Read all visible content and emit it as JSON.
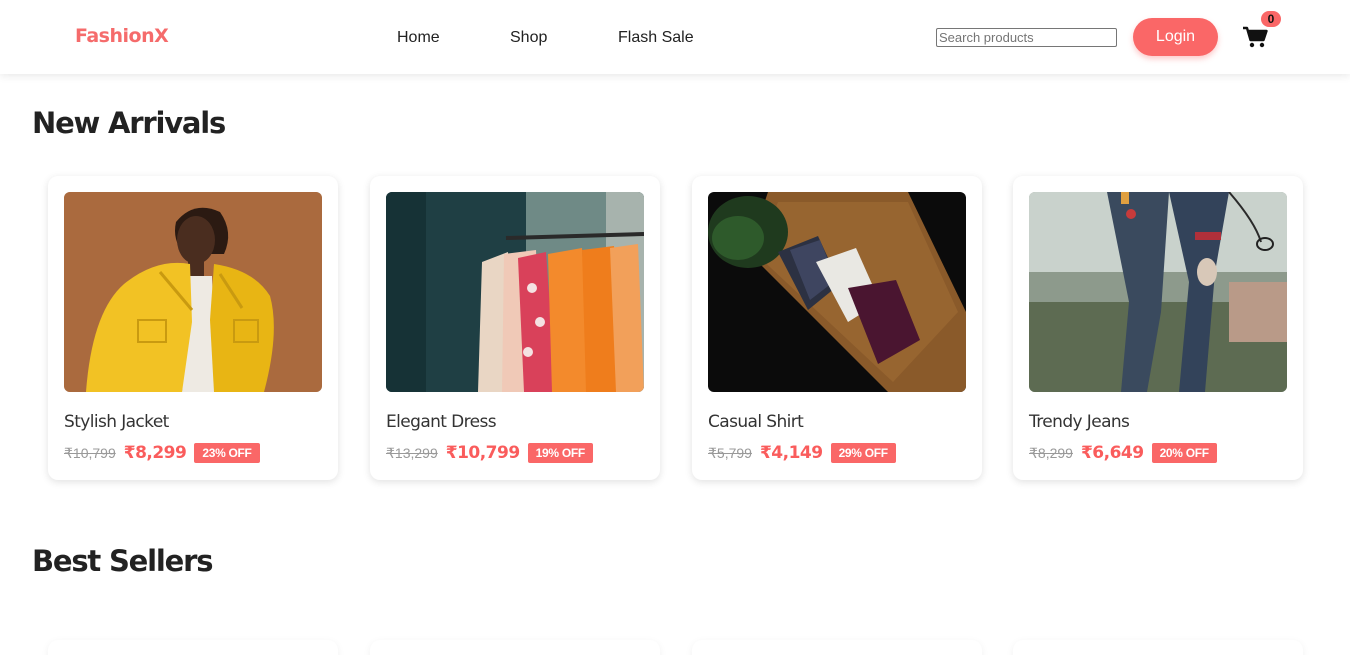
{
  "header": {
    "logo": "FashionX",
    "nav": [
      "Home",
      "Shop",
      "Flash Sale"
    ],
    "search_placeholder": "Search products",
    "search_value": "",
    "login_label": "Login",
    "cart_icon": "shopping-cart-icon",
    "cart_count": "0"
  },
  "colors": {
    "accent": "#fa6767",
    "logo": "#f56b6b",
    "price": "#fa5c5c"
  },
  "new_arrivals": {
    "title": "New Arrivals",
    "products": [
      {
        "name": "Stylish Jacket",
        "old_price": "₹10,799",
        "price": "₹8,299",
        "discount": "23% OFF"
      },
      {
        "name": "Elegant Dress",
        "old_price": "₹13,299",
        "price": "₹10,799",
        "discount": "19% OFF"
      },
      {
        "name": "Casual Shirt",
        "old_price": "₹5,799",
        "price": "₹4,149",
        "discount": "29% OFF"
      },
      {
        "name": "Trendy Jeans",
        "old_price": "₹8,299",
        "price": "₹6,649",
        "discount": "20% OFF"
      }
    ]
  },
  "best_sellers": {
    "title": "Best Sellers"
  }
}
